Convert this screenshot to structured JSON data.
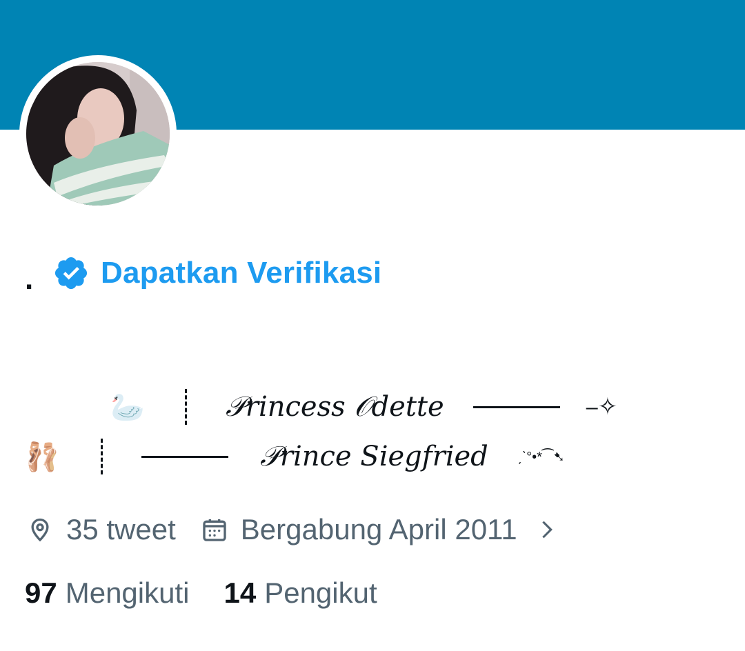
{
  "profile": {
    "display_name": ".",
    "verify_label": "Dapatkan Verifikasi",
    "bio": {
      "line1_emoji_left": "🦢",
      "line1_text": "𝒫rincess 𝒪dette",
      "line1_trail": "⎯✧",
      "line2_emoji_left": "🩰",
      "line2_text": "𝒫rince Siegfried",
      "line2_trail": "ˏˋ°•*⁀➷"
    },
    "location": "35 tweet",
    "joined": "Bergabung April 2011",
    "following_count": "97",
    "following_label": "Mengikuti",
    "followers_count": "14",
    "followers_label": "Pengikut"
  },
  "colors": {
    "banner": "#0084b4",
    "accent": "#1d9bf0",
    "secondary_text": "#536471"
  },
  "icons": {
    "verify": "verified-badge-icon",
    "location": "location-pin-icon",
    "calendar": "calendar-icon",
    "chevron": "chevron-right-icon"
  }
}
